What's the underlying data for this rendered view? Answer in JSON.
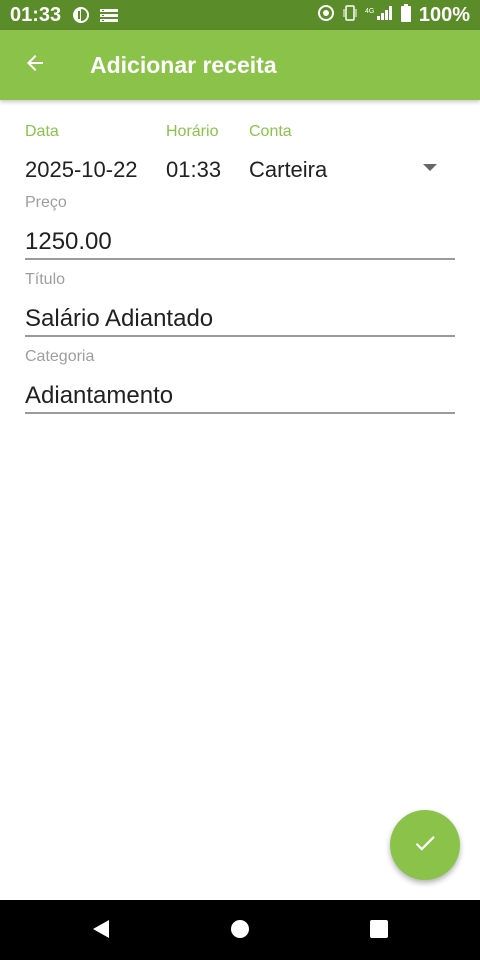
{
  "status_bar": {
    "time": "01:33",
    "battery_text": "100%",
    "icons": [
      "data-saver-icon",
      "notification-list-icon",
      "sync-icon",
      "vibrate-icon",
      "signal-4g-icon",
      "battery-icon"
    ]
  },
  "app_bar": {
    "back_icon": "arrow-left-icon",
    "title": "Adicionar receita"
  },
  "form": {
    "date_label": "Data",
    "date_value": "2025-10-22",
    "time_label": "Horário",
    "time_value": "01:33",
    "account_label": "Conta",
    "account_value": "Carteira",
    "price_label": "Preço",
    "price_value": "1250.00",
    "title_label": "Título",
    "title_value": "Salário Adiantado",
    "category_label": "Categoria",
    "category_value": "Adiantamento"
  },
  "fab": {
    "icon": "check-icon"
  },
  "nav_bar": {
    "icons": [
      "back-triangle-icon",
      "home-circle-icon",
      "recents-square-icon"
    ]
  },
  "colors": {
    "status_bar": "#5b8c2a",
    "accent": "#8bc34a",
    "label_grey": "#9e9e9e",
    "text": "#212121"
  }
}
